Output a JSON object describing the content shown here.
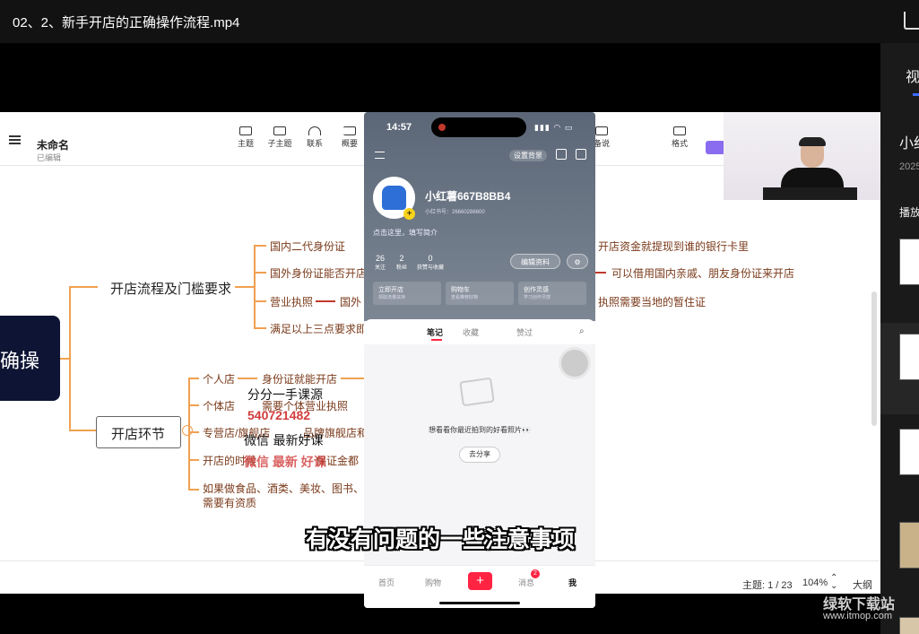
{
  "window": {
    "title": "02、2、新手开店的正确操作流程.mp4"
  },
  "right_panel": {
    "tab_label": "视",
    "course_title": "小红",
    "year": "2025",
    "section": "播放"
  },
  "mindmap_app": {
    "doc_title": "未命名",
    "doc_status": "已编辑",
    "toolbar": [
      "主题",
      "子主题",
      "联系",
      "概要",
      "备说",
      "格式"
    ],
    "root_node": "确操",
    "branch1": {
      "label": "开店流程及门槛要求",
      "children": [
        "国内二代身份证",
        "国外身份证能否开店",
        "营业执照",
        "满足以上三点要求即"
      ],
      "child3_sub": "国外",
      "right_notes": [
        "开店资金就提现到谁的银行卡里",
        "可以借用国内亲戚、朋友身份证来开店",
        "执照需要当地的暂住证"
      ]
    },
    "branch2": {
      "label": "开店环节",
      "children": [
        "个人店",
        "个体店",
        "专营店/旗舰店",
        "开店的时候",
        "如果做食品、酒类、美妆、图书、麦",
        "需要有资质"
      ],
      "child1_sub": "身份证就能开店",
      "child2_sub": "需要个体营业执照",
      "child3_tail": "品牌旗舰店和旨",
      "child4_tail": "保证金都"
    },
    "status": {
      "topic_count": "主题: 1 / 23",
      "zoom": "104%",
      "outline": "大纲"
    }
  },
  "phone": {
    "time": "14:57",
    "username": "小红薯667B8BB4",
    "user_id": "小红书号：26660286600",
    "bio": "点击这里，填写简介",
    "stats": [
      {
        "n": "26",
        "l": "关注"
      },
      {
        "n": "2",
        "l": "粉丝"
      },
      {
        "n": "0",
        "l": "获赞与收藏"
      }
    ],
    "edit_btn": "编辑资料",
    "bg_btn": "设置背景",
    "quick": [
      {
        "t": "立即开店",
        "s": "领取流量扶持"
      },
      {
        "t": "购物车",
        "s": "查看推荐好物"
      },
      {
        "t": "创作灵感",
        "s": "学习创作灵感"
      }
    ],
    "tabs": [
      "笔记",
      "收藏",
      "赞过"
    ],
    "empty_text": "想看看你最近拍到的好看照片👀",
    "share_btn": "去分享",
    "nav": [
      "首页",
      "购物",
      "+",
      "消息",
      "我"
    ],
    "msg_badge": "2"
  },
  "watermarks": {
    "a": "分分一手课源",
    "b": "540721482",
    "c": "微信 最新好课",
    "d": "微信 最新 好课"
  },
  "subtitle": "有没有问题的一些注意事项",
  "site_watermark": {
    "name": "绿软下载站",
    "url": "www.itmop.com"
  },
  "colors": {
    "orange": "#f0a050",
    "dark_node": "#0e1433",
    "phone_header": "#6a7585",
    "red": "#ff2442"
  }
}
